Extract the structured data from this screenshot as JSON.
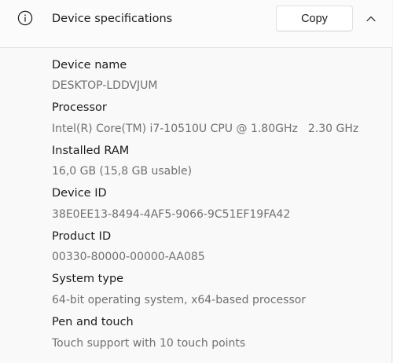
{
  "header": {
    "icon": "info-icon",
    "title": "Device specifications",
    "copy_label": "Copy",
    "collapse_icon": "chevron-up-icon"
  },
  "specs": [
    {
      "label": "Device name",
      "value": "DESKTOP-LDDVJUM"
    },
    {
      "label": "Processor",
      "value": "Intel(R) Core(TM) i7-10510U CPU @ 1.80GHz",
      "value_extra": "2.30 GHz"
    },
    {
      "label": "Installed RAM",
      "value": "16,0 GB (15,8 GB usable)"
    },
    {
      "label": "Device ID",
      "value": "38E0EE13-8494-4AF5-9066-9C51EF19FA42"
    },
    {
      "label": "Product ID",
      "value": "00330-80000-00000-AA085"
    },
    {
      "label": "System type",
      "value": "64-bit operating system, x64-based processor"
    },
    {
      "label": "Pen and touch",
      "value": "Touch support with 10 touch points"
    }
  ]
}
